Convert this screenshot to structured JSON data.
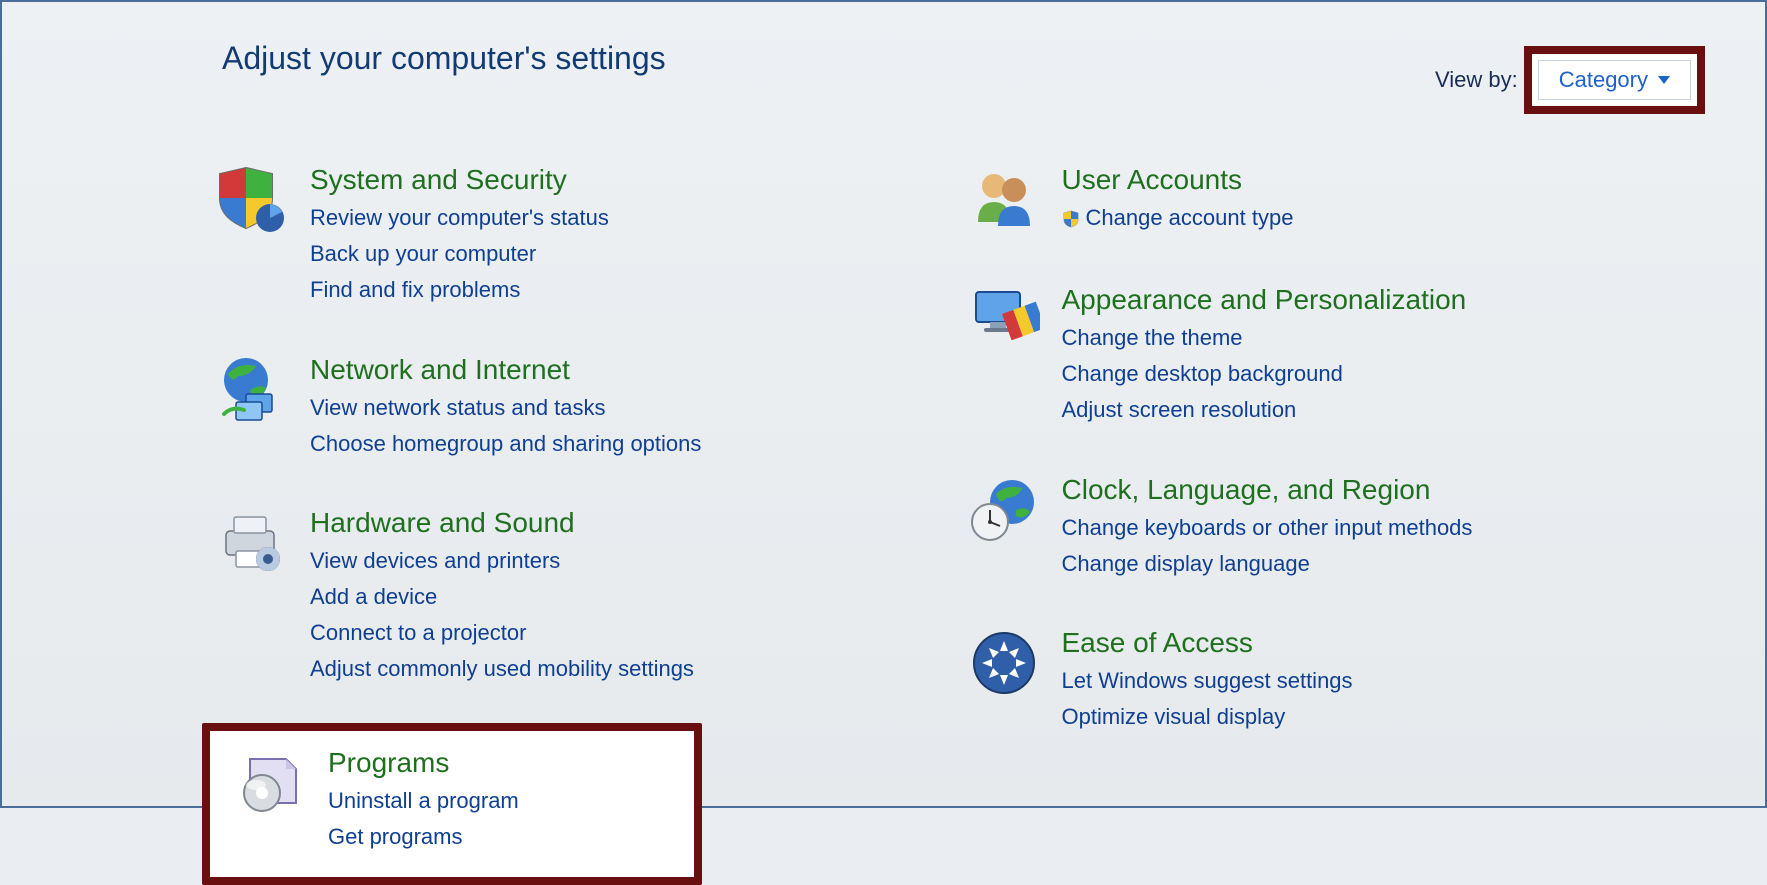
{
  "header": {
    "title": "Adjust your computer's settings",
    "view_by_label": "View by:",
    "view_by_value": "Category"
  },
  "left": [
    {
      "id": "system-security",
      "title": "System and Security",
      "links": [
        "Review your computer's status",
        "Back up your computer",
        "Find and fix problems"
      ]
    },
    {
      "id": "network-internet",
      "title": "Network and Internet",
      "links": [
        "View network status and tasks",
        "Choose homegroup and sharing options"
      ]
    },
    {
      "id": "hardware-sound",
      "title": "Hardware and Sound",
      "links": [
        "View devices and printers",
        "Add a device",
        "Connect to a projector",
        "Adjust commonly used mobility settings"
      ]
    },
    {
      "id": "programs",
      "title": "Programs",
      "highlight": true,
      "links": [
        "Uninstall a program",
        "Get programs"
      ]
    }
  ],
  "right": [
    {
      "id": "user-accounts",
      "title": "User Accounts",
      "links": [
        "Change account type"
      ],
      "link_shield": [
        true
      ]
    },
    {
      "id": "appearance-personalization",
      "title": "Appearance and Personalization",
      "links": [
        "Change the theme",
        "Change desktop background",
        "Adjust screen resolution"
      ]
    },
    {
      "id": "clock-language-region",
      "title": "Clock, Language, and Region",
      "links": [
        "Change keyboards or other input methods",
        "Change display language"
      ]
    },
    {
      "id": "ease-of-access",
      "title": "Ease of Access",
      "links": [
        "Let Windows suggest settings",
        "Optimize visual display"
      ]
    }
  ]
}
